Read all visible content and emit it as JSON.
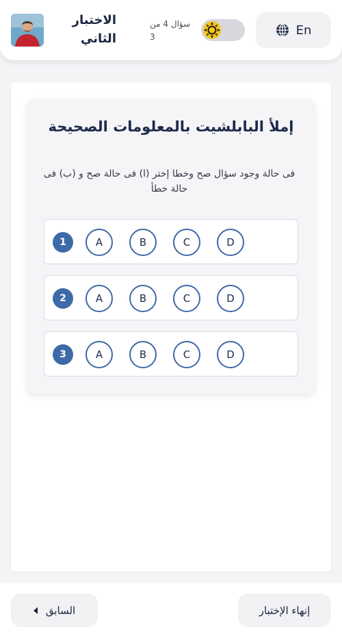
{
  "header": {
    "quiz_title": "الاختبار الثاني",
    "question_counter_line1": "سؤال 4 من",
    "question_counter_line2": "3",
    "language_label": "En",
    "avatar_icon": "user-avatar-photo",
    "theme_icon": "sun-icon",
    "language_icon": "globe-icon"
  },
  "question": {
    "title": "إملأ البابلشيت بالمعلومات الصحيحة",
    "instructions": "فى حالة وجود سؤال صح وخطا إختر (ا) فى حالة صح و (ب) فى حالة خطأ",
    "rows": [
      {
        "number": "1",
        "choices": [
          "A",
          "B",
          "C",
          "D"
        ]
      },
      {
        "number": "2",
        "choices": [
          "A",
          "B",
          "C",
          "D"
        ]
      },
      {
        "number": "3",
        "choices": [
          "A",
          "B",
          "C",
          "D"
        ]
      }
    ]
  },
  "footer": {
    "previous_label": "السابق",
    "finish_label": "إنهاء الإختبار"
  },
  "colors": {
    "accent": "#3e6aa7",
    "title": "#1c2a4c",
    "background": "#f4f3f6",
    "toggle_track": "#d7d8de",
    "sun": "#f5c518"
  }
}
